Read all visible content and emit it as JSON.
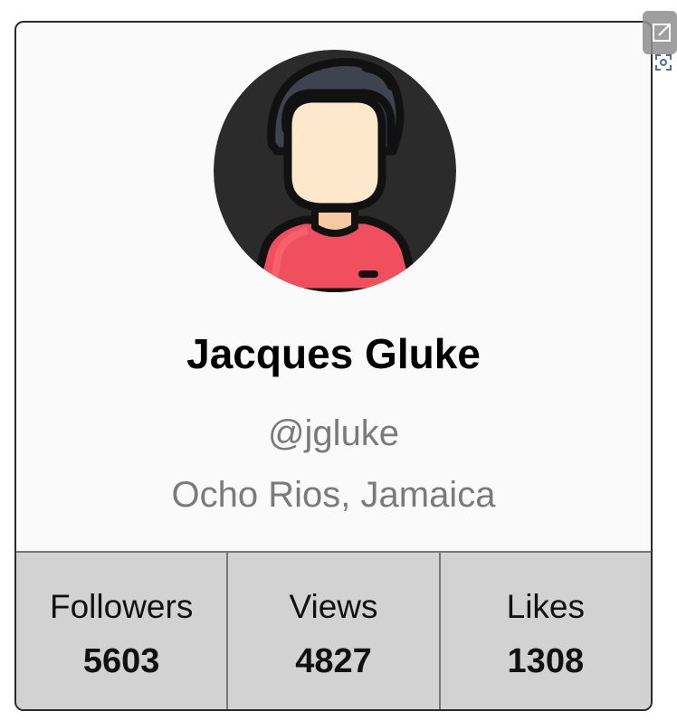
{
  "profile": {
    "name": "Jacques Gluke",
    "handle": "@jgluke",
    "location": "Ocho Rios, Jamaica",
    "avatar_icon": "user-avatar-icon"
  },
  "stats": [
    {
      "label": "Followers",
      "value": "5603"
    },
    {
      "label": "Views",
      "value": "4827"
    },
    {
      "label": "Likes",
      "value": "1308"
    }
  ],
  "colors": {
    "card_bg": "#fafafa",
    "border": "#2a2a2a",
    "stats_bg": "#d2d2d2",
    "muted_text": "#7a7a7a",
    "avatar_bg": "#2b2b2b",
    "avatar_hair": "#3f4350",
    "avatar_skin": "#fde8cc",
    "avatar_shirt": "#f0505d"
  },
  "widget": {
    "icon": "expand-icon",
    "sub_icon": "focus-icon"
  }
}
